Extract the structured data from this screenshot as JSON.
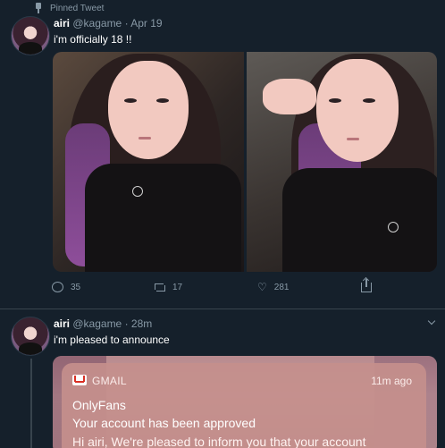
{
  "tweet1": {
    "pinned_label": "Pinned Tweet",
    "name": "airi",
    "handle": "@kagame",
    "separator": "·",
    "time": "Apr 19",
    "text": "i'm officially 18 !!",
    "actions": {
      "reply_count": "35",
      "retweet_count": "17",
      "like_count": "281"
    }
  },
  "tweet2": {
    "name": "airi",
    "handle": "@kagame",
    "separator": "·",
    "time": "28m",
    "text": "i'm pleased to announce",
    "notification": {
      "app": "GMAIL",
      "time": "11m ago",
      "title": "OnlyFans",
      "subtitle": "Your account has been approved",
      "body": "Hi airi, We're pleased to inform you that your account"
    }
  },
  "colors": {
    "background": "#15202b",
    "secondary_text": "#8899a6",
    "notification_bg": "#c48f8c"
  },
  "icons": [
    "pin-icon",
    "caret-down-icon",
    "reply-icon",
    "retweet-icon",
    "heart-icon",
    "share-icon",
    "gmail-icon"
  ]
}
